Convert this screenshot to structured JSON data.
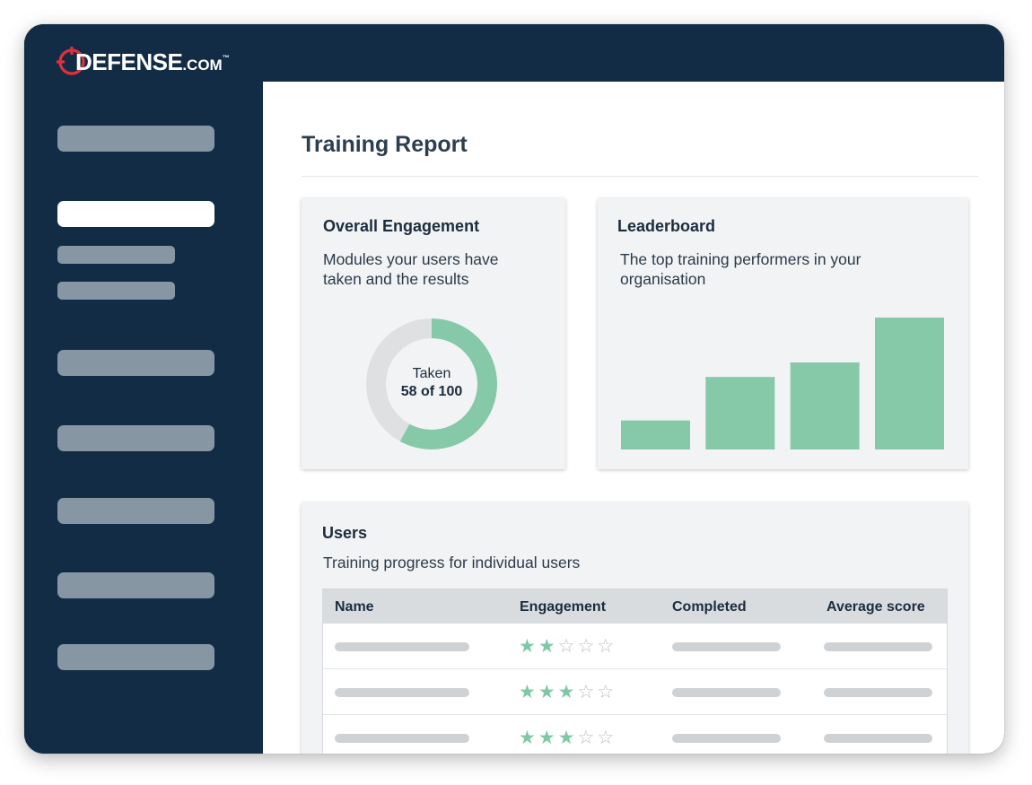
{
  "brand": {
    "logo_text": "DEFENSE",
    "logo_suffix": ".COM",
    "logo_tm": "™",
    "accent_color": "#e0303a",
    "sidebar_color": "#132c45"
  },
  "sidebar": {
    "items": [
      {
        "name": "nav-item-1",
        "active": false
      },
      {
        "name": "nav-item-2",
        "active": true
      },
      {
        "name": "nav-item-3",
        "active": false
      },
      {
        "name": "nav-item-4",
        "active": false
      },
      {
        "name": "nav-item-5",
        "active": false
      },
      {
        "name": "nav-item-6",
        "active": false
      },
      {
        "name": "nav-item-7",
        "active": false
      },
      {
        "name": "nav-item-8",
        "active": false
      },
      {
        "name": "nav-item-9",
        "active": false
      }
    ]
  },
  "page": {
    "title": "Training Report"
  },
  "engagement": {
    "title": "Overall Engagement",
    "description_line1": "Modules your users have",
    "description_line2": "taken and the results",
    "donut_label_line1": "Taken",
    "donut_label_line2": "58 of 100",
    "taken": 58,
    "total": 100,
    "fill_color": "#86c9a8",
    "track_color": "#dfe0e1"
  },
  "leaderboard": {
    "title": "Leaderboard",
    "description_line1": "The top training performers in your",
    "description_line2": "organisation",
    "chart_data": {
      "type": "bar",
      "categories": [
        "",
        "",
        "",
        ""
      ],
      "values": [
        22,
        55,
        66,
        100
      ],
      "ylim": [
        0,
        100
      ],
      "color": "#86c9a8",
      "grid": false
    }
  },
  "users": {
    "title": "Users",
    "description": "Training progress for individual users",
    "columns": [
      "Name",
      "Engagement",
      "Completed",
      "Average score"
    ],
    "rows": [
      {
        "stars": 2,
        "max_stars": 5
      },
      {
        "stars": 3,
        "max_stars": 5
      },
      {
        "stars": 3,
        "max_stars": 5
      }
    ]
  }
}
